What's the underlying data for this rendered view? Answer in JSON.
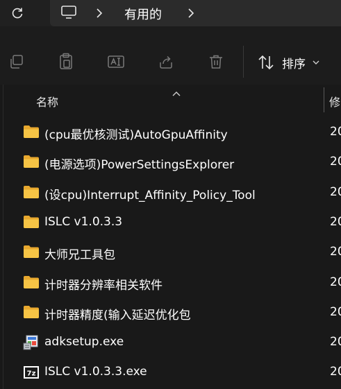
{
  "addressbar": {
    "breadcrumb": "有用的",
    "icons": [
      "refresh-icon",
      "this-pc-icon",
      "chevron-right-icon"
    ]
  },
  "toolbar": {
    "buttons": [
      "copy-icon",
      "paste-icon",
      "rename-icon",
      "share-icon",
      "delete-icon"
    ],
    "sort_label": "排序"
  },
  "columns": {
    "name": "名称",
    "modified": "修"
  },
  "files": [
    {
      "name": "(cpu最优核测试)AutoGpuAffinity",
      "type": "folder",
      "date": "20"
    },
    {
      "name": "(电源选项)PowerSettingsExplorer",
      "type": "folder",
      "date": "20"
    },
    {
      "name": "(设cpu)Interrupt_Affinity_Policy_Tool",
      "type": "folder",
      "date": "20"
    },
    {
      "name": "ISLC v1.0.3.3",
      "type": "folder",
      "date": "20"
    },
    {
      "name": "大师兄工具包",
      "type": "folder",
      "date": "20"
    },
    {
      "name": "计时器分辨率相关软件",
      "type": "folder",
      "date": "20"
    },
    {
      "name": "计时器精度(输入延迟优化包",
      "type": "folder",
      "date": "20"
    },
    {
      "name": "adksetup.exe",
      "type": "installer",
      "date": "20"
    },
    {
      "name": "ISLC v1.0.3.3.exe",
      "type": "7z",
      "date": "20"
    }
  ],
  "colors": {
    "background": "#191919",
    "folder": "#f6c445",
    "text": "#ffffff"
  }
}
